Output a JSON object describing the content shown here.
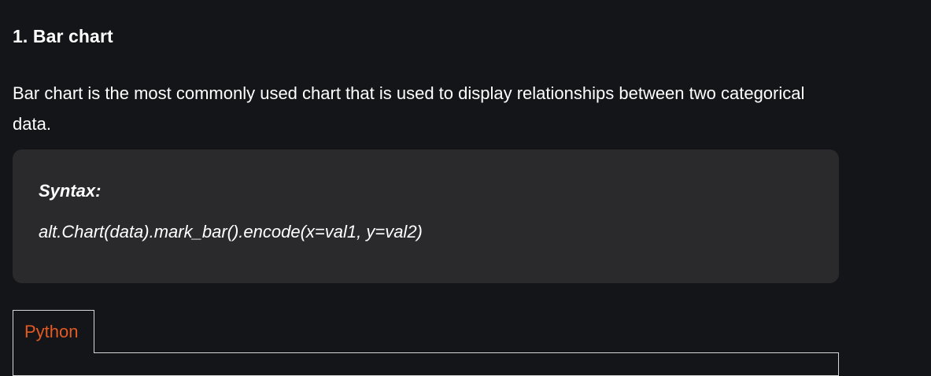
{
  "section": {
    "heading": "1. Bar chart",
    "intro": "Bar chart is the most commonly used chart that is used to display relationships between two categorical data."
  },
  "syntax": {
    "label": "Syntax:",
    "code": "alt.Chart(data).mark_bar().encode(x=val1, y=val2)"
  },
  "tabs": [
    {
      "label": "Python",
      "active": true
    }
  ],
  "colors": {
    "background": "#141519",
    "syntax_box": "#2a2a2d",
    "tab_label": "#e25a24",
    "text": "#ffffff",
    "border": "#d6d6d6"
  }
}
